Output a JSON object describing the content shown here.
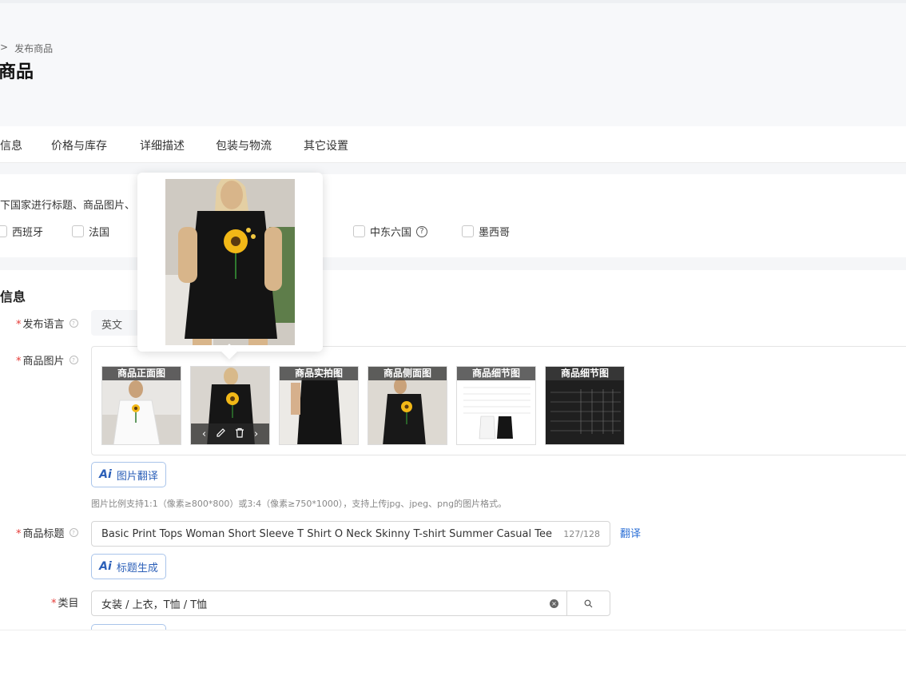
{
  "breadcrumb": {
    "sep": ">",
    "current": "发布商品"
  },
  "page_title": "商品",
  "tabs": [
    "信息",
    "价格与库存",
    "详细描述",
    "包装与物流",
    "其它设置"
  ],
  "country": {
    "desc": "下国家进行标题、商品图片、",
    "options": [
      "西班牙",
      "法国",
      "中东六国",
      "墨西哥"
    ]
  },
  "section_title": "信息",
  "form": {
    "lang_label": "发布语言",
    "lang_value": "英文",
    "img_label": "商品图片",
    "thumb_labels": [
      "商品正面图",
      "",
      "商品实拍图",
      "商品侧面图",
      "商品细节图",
      "商品细节图"
    ],
    "thumb_toolbar": {
      "prev": "‹",
      "next": "›"
    },
    "img_translate_btn": "图片翻译",
    "img_hint": "图片比例支持1:1（像素≥800*800）或3:4（像素≥750*1000），支持上传jpg、jpeg、png的图片格式。",
    "title_label": "商品标题",
    "title_value": "Basic Print Tops Woman Short Sleeve T Shirt O Neck Skinny T-shirt Summer Casual Tee For Women",
    "title_count": "127/128",
    "translate_link": "翻译",
    "title_gen_btn": "标题生成",
    "category_label": "类目",
    "category_value": "女装 / 上衣，T恤 / T恤"
  },
  "ai_mark": "Ai",
  "required_mark": "*",
  "colors": {
    "accent": "#2b6fd6",
    "required": "#e53935"
  }
}
